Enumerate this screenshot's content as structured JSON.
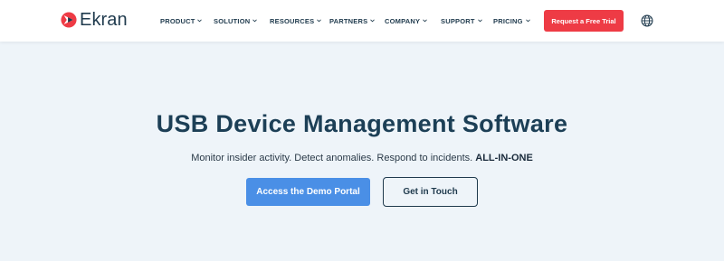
{
  "brand": {
    "name": "Ekran",
    "accent": "#ee3b45",
    "primary_text": "#1f3a4d"
  },
  "nav": {
    "items": [
      {
        "label": "PRODUCT"
      },
      {
        "label": "SOLUTION"
      },
      {
        "label": "RESOURCES"
      },
      {
        "label": "PARTNERS"
      },
      {
        "label": "COMPANY"
      },
      {
        "label": "SUPPORT"
      },
      {
        "label": "PRICING"
      }
    ],
    "cta_label": "Request a Free Trial",
    "language_icon": "globe-icon"
  },
  "hero": {
    "title": "USB Device Management Software",
    "subtitle": "Monitor insider activity. Detect anomalies. Respond to incidents.",
    "subtitle_emphasis": "ALL-IN-ONE",
    "primary_button": "Access the Demo Portal",
    "secondary_button": "Get in Touch",
    "primary_color": "#4a8fe6"
  }
}
